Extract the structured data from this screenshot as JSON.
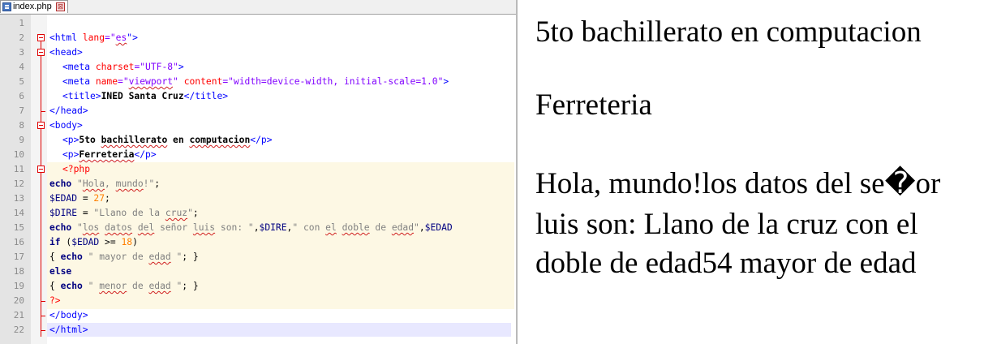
{
  "editor": {
    "tab": {
      "title": "index.php",
      "close_glyph": "⊠"
    },
    "lines": [
      "1",
      "2",
      "3",
      "4",
      "5",
      "6",
      "7",
      "8",
      "9",
      "10",
      "11",
      "12",
      "13",
      "14",
      "15",
      "16",
      "17",
      "18",
      "19",
      "20",
      "21",
      "22"
    ],
    "code": {
      "l2": {
        "open": "<html",
        "attr": "lang",
        "eq": "=\"",
        "val": "es",
        "close": "\">"
      },
      "l3": "<head>",
      "l4": {
        "open": "<meta",
        "attr": "charset",
        "val": "=\"UTF-8\"",
        "close": ">"
      },
      "l5": {
        "open": "<meta",
        "attr1": "name",
        "val1a": "=\"",
        "val1b": "viewport",
        "val1c": "\"",
        "attr2": "content",
        "val2": "=\"width=device-width, initial-scale=1.0\"",
        "close": ">"
      },
      "l6": {
        "open": "<title>",
        "text": "INED Santa Cruz",
        "close": "</title>"
      },
      "l7": "</head>",
      "l8": "<body>",
      "l9": {
        "open": "<p>",
        "t1": "5to ",
        "t2": "bachillerato",
        "t3": " en ",
        "t4": "computacion",
        "close": "</p>"
      },
      "l10": {
        "open": "<p>",
        "text": "Ferreteria",
        "close": "</p>"
      },
      "l11": "<?php",
      "l12": {
        "kw": "echo",
        "s1": " \"",
        "s2": "Hola",
        "s3": ", ",
        "s4": "mundo",
        "s5": "!\"",
        "end": ";"
      },
      "l13": {
        "var": "$EDAD",
        "op": " = ",
        "num": "27",
        "end": ";"
      },
      "l14": {
        "var": "$DIRE",
        "op": " = ",
        "s1": "\"Llano de la ",
        "s2": "cruz",
        "s3": "\"",
        "end": ";"
      },
      "l15": {
        "kw": "echo",
        "s1": " \"",
        "s2": "los",
        "s3": " ",
        "s4": "datos",
        "s5": " ",
        "s6": "del",
        "s7": " señor ",
        "s8": "luis",
        "s9": " son: \"",
        "c1": ",",
        "var1": "$DIRE",
        "c2": ",",
        "s10": "\" con ",
        "s11": "el",
        "s12": " ",
        "s13": "doble",
        "s14": " de ",
        "s15": "edad",
        "s16": "\"",
        "c3": ",",
        "var2": "$EDAD"
      },
      "l16": {
        "kw": "if",
        "p1": " (",
        "var": "$EDAD",
        "op": " >= ",
        "num": "18",
        "p2": ")"
      },
      "l17": {
        "b1": "{ ",
        "kw": "echo",
        "s1": " \" mayor de ",
        "s2": "edad",
        "s3": " \"",
        "end": "; }"
      },
      "l18": "else",
      "l19": {
        "b1": "{ ",
        "kw": "echo",
        "s1": " \" ",
        "s2": "menor",
        "s3": " de ",
        "s4": "edad",
        "s5": " \"",
        "end": "; }"
      },
      "l20": "?>",
      "l21": "</body>",
      "l22": "</html>"
    }
  },
  "output": {
    "p1": "5to bachillerato en computacion",
    "p2": "Ferreteria",
    "p3_line1": "Hola, mundo!los datos del se�or",
    "p3_line2": "luis son: Llano de la cruz con el",
    "p3_line3": "doble de edad54 mayor de edad"
  }
}
